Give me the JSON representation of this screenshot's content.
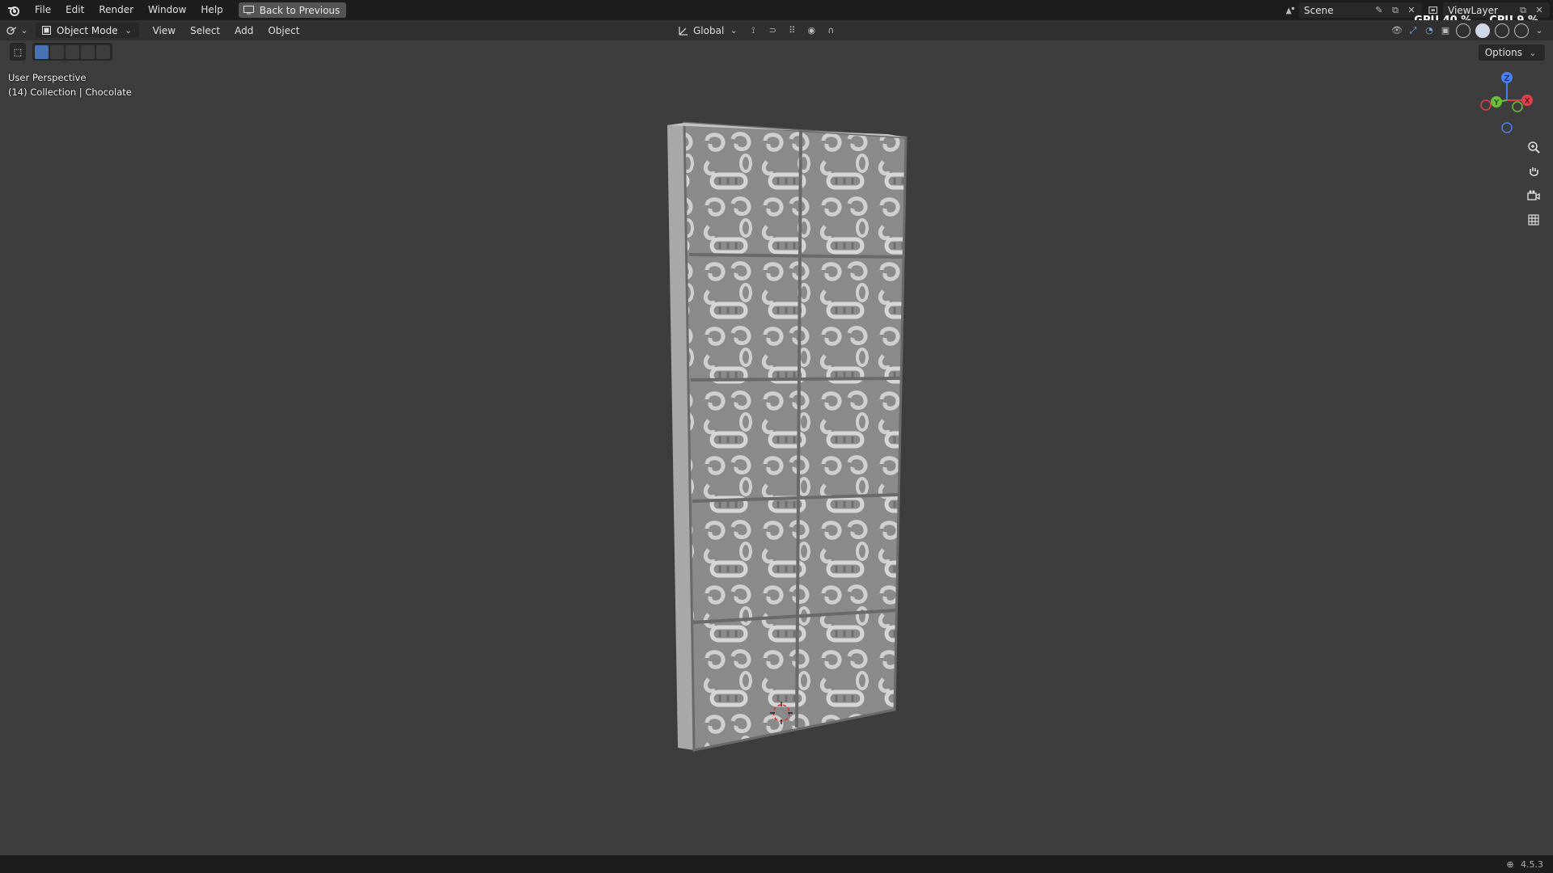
{
  "menu": {
    "file": "File",
    "edit": "Edit",
    "render": "Render",
    "window": "Window",
    "help": "Help",
    "back": "Back to Previous"
  },
  "top_right": {
    "scene": "Scene",
    "view_layer": "ViewLayer"
  },
  "stats": {
    "gpu_label": "GPU",
    "gpu_value": "40 %",
    "cpu_label": "CPU",
    "cpu_value": "9 %"
  },
  "header": {
    "mode": "Object Mode",
    "view": "View",
    "select": "Select",
    "add": "Add",
    "object": "Object",
    "orientation": "Global"
  },
  "options": "Options",
  "viewport": {
    "perspective": "User Perspective",
    "collection": "(14) Collection | Chocolate"
  },
  "gizmo": {
    "z": "Z",
    "y": "Y",
    "x": "X"
  },
  "version": "4.5.3"
}
